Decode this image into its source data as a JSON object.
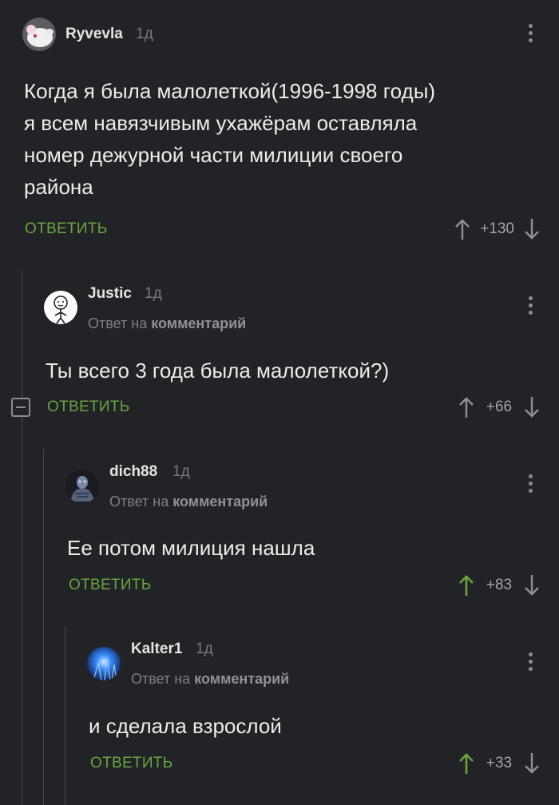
{
  "reply_label": "ОТВЕТИТЬ",
  "reply_note_prefix": "Ответ на",
  "reply_note_link": "комментарий",
  "colors": {
    "background": "#222327",
    "accent_green": "#6aa53d",
    "thread_line": "#47484c",
    "muted": "#777a80"
  },
  "comments": [
    {
      "author": "Ryvevla",
      "time": "1д",
      "avatar": "white-rat-avatar",
      "lines": [
        "Когда я была малолеткой(1996-1998 годы)",
        "я всем навязчивым ухажёрам оставляла",
        "номер дежурной части милиции своего",
        "района"
      ],
      "score": "+130",
      "upvoted": false
    },
    {
      "author": "Justic",
      "time": "1д",
      "avatar": "stick-figure-avatar",
      "lines": [
        "Ты всего 3 года была малолеткой?)"
      ],
      "score": "+66",
      "upvoted": false
    },
    {
      "author": "dich88",
      "time": "1д",
      "avatar": "dark-figure-avatar",
      "lines": [
        "Ее потом милиция нашла"
      ],
      "score": "+83",
      "upvoted": true
    },
    {
      "author": "Kalter1",
      "time": "1д",
      "avatar": "blue-glow-avatar",
      "lines": [
        "и сделала взрослой"
      ],
      "score": "+33",
      "upvoted": true
    }
  ]
}
